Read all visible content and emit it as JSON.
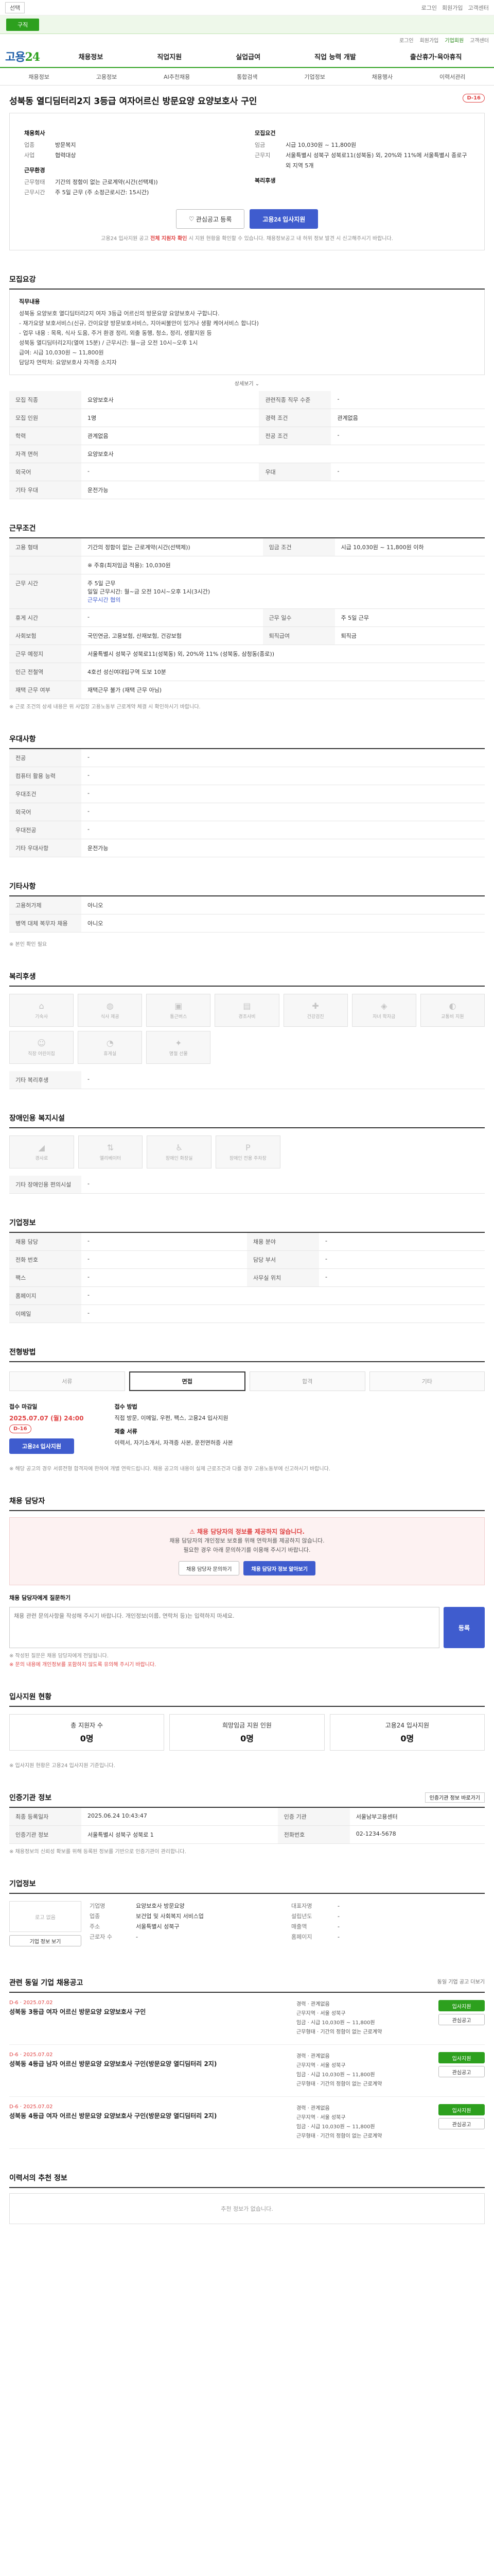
{
  "topbar": {
    "select": "선택",
    "links": [
      "로그인",
      "회원가입",
      "고객센터"
    ]
  },
  "banner": {
    "pill": "구직"
  },
  "util": {
    "links": [
      "로그인",
      "회원가입",
      "기업회원",
      "고객센터"
    ]
  },
  "gnb": {
    "logo_a": "고용",
    "logo_b": "24",
    "menu": [
      "채용정보",
      "직업지원",
      "실업급여",
      "직업 능력 개발",
      "출산휴가·육아휴직"
    ]
  },
  "lnb": [
    "채용정보",
    "고용정보",
    "AI추천채용",
    "통합검색",
    "기업정보",
    "채용행사",
    "이력서관리"
  ],
  "job": {
    "title": "성북동 열디딤터리2지 3등급 여자어르신 방문요양 요양보호사 구인",
    "dday": "D-16"
  },
  "summary": {
    "left_title": "채용회사",
    "left": [
      {
        "k": "업종",
        "v": "방문복지"
      },
      {
        "k": "사업",
        "v": "협력대상"
      }
    ],
    "left_title2": "근무환경",
    "left2": [
      {
        "k": "근무형태",
        "v": "기간의 정함이 없는 근로계약(시간(선택제))"
      },
      {
        "k": "근무시간",
        "v": "주 5일 근무 (주 소정근로시간: 15시간)"
      }
    ],
    "right_title": "모집요건",
    "right": [
      {
        "k": "임금",
        "v": "시급 10,030원 ~ 11,800원"
      },
      {
        "k": "근무지",
        "v": "서울특별시 성북구 성북로11(성북동) 외, 20%와 11%에 서울특별시 종로구 외 지역 5개"
      }
    ],
    "right_title2": "복리후생",
    "right2": [],
    "btn_save": "관심공고 등록",
    "btn_apply": "고용24 입사지원",
    "notice_pre": "고용24 입사지원 공고 ",
    "notice_red": "전체 지원자 확인",
    "notice_post": " 시 지원 현황을 확인할 수 있습니다. 채용정보공고 내 허위 정보 발견 시 신고해주시기 바랍니다."
  },
  "s_offer": {
    "title": "모집요강",
    "desc_label": "직무내용",
    "desc": [
      "성북동 요양보호 열디딤터리2지 여자 3등급 어르신의 방문요양 요양보호사 구합니다.",
      "- 재가요양 보호서비스(신규, 간이요양 방문보호서비스, 지아씨불안이 있거나 생활 케어서비스 합니다)",
      "- 업무 내용 : 목욕, 식사 도움, 주거 환경 정리, 외출 동행, 청소, 정리, 생활지원 등",
      "  성북동 열디딤터리2지(열여 15분) / 근무시간: 월~금 오전 10시~오후 1시",
      "  급여: 시급 10,030원 ~ 11,800원",
      "  담당자 연락처: 요양보호사 자격증 소지자"
    ],
    "more": "상세보기",
    "rows": [
      [
        "모집 직종",
        "요양보호사",
        "관련직종 직무 수준",
        "-"
      ],
      [
        "모집 인원",
        "1명",
        "경력 조건",
        "관계없음"
      ],
      [
        "학력",
        "관계없음",
        "전공 조건",
        "-"
      ],
      [
        "자격 면허",
        "요양보호사",
        "",
        ""
      ],
      [
        "외국어",
        "-",
        "우대",
        "-"
      ],
      [
        "기타 우대",
        "운전가능",
        "",
        ""
      ]
    ]
  },
  "s_work": {
    "title": "근무조건",
    "r1": [
      "고용 형태",
      "기간의 정함이 없는 근로계약(시간(선택제))",
      "임금 조건",
      "시급 10,030원 ~ 11,800원 이하"
    ],
    "wage_note": "※ 주휴(최저임금 적용): 10,030원",
    "time_label": "근무 시간",
    "time_lines": [
      "주 5일 근무",
      "일일 근무시간: 월~금 오전 10시~오후 1시(3시간)",
      "근무시간 협의"
    ],
    "rows": [
      [
        "휴게 시간",
        "-",
        "근무 일수",
        "주 5일 근무"
      ],
      [
        "사회보험",
        "국민연금, 고용보험, 산재보험, 건강보험",
        "퇴직급여",
        "퇴직금"
      ],
      [
        "근무 예정지",
        "서울특별시 성북구 성북로11(성북동) 외, 20%와 11% (성북동, 삼청동(종로))",
        "",
        ""
      ],
      [
        "인근 전철역",
        "4호선 성신여대입구역 도보 10분",
        "",
        ""
      ],
      [
        "재택 근무 여부",
        "재택근무 불가 (재택 근무 아님)",
        "",
        ""
      ]
    ],
    "cap": "※ 근로 조건의 상세 내용은 위 사업장 고용노동부 근로계약 체결 시 확인하시기 바랍니다."
  },
  "s_pref": {
    "title": "우대사항",
    "rows": [
      [
        "전공",
        "-"
      ],
      [
        "컴퓨터 활용 능력",
        "-"
      ],
      [
        "우대조건",
        "-"
      ],
      [
        "외국어",
        "-"
      ],
      [
        "우대전공",
        "-"
      ],
      [
        "기타 우대사항",
        "운전가능"
      ]
    ]
  },
  "s_etc": {
    "title": "기타사항",
    "rows": [
      [
        "고용허가제",
        "아니오"
      ],
      [
        "병역 대체 복무자 채용",
        "아니오"
      ]
    ],
    "note": "※ 본인 확인 필요"
  },
  "s_welfare": {
    "title": "복리후생",
    "icons": [
      [
        "house-icon",
        "기숙사"
      ],
      [
        "meal-icon",
        "식사 제공"
      ],
      [
        "bus-icon",
        "통근버스"
      ],
      [
        "gift-icon",
        "경조사비"
      ],
      [
        "health-icon",
        "건강검진"
      ],
      [
        "support-icon",
        "자녀 학자금"
      ],
      [
        "car-icon",
        "교통비 지원"
      ],
      [
        "child-icon",
        "직장 어린이집"
      ],
      [
        "coffee-icon",
        "휴게실"
      ],
      [
        "party-icon",
        "명절 선물"
      ]
    ],
    "etc_label": "기타 복리후생",
    "etc": "-"
  },
  "s_disability": {
    "title": "장애인용 복지시설",
    "icons": [
      [
        "ramp-icon",
        "경사로"
      ],
      [
        "lift-icon",
        "엘리베이터"
      ],
      [
        "toilet-icon",
        "장애인 화장실"
      ],
      [
        "parking-icon",
        "장애인 전용 주차장"
      ]
    ],
    "etc_label": "기타 장애인용 편의시설",
    "etc": "-"
  },
  "s_company": {
    "title": "채용 담당자",
    "rows": [
      [
        "채용 담당",
        "-"
      ],
      [
        "전화 번호",
        "-"
      ],
      [
        "팩스",
        "-"
      ],
      [
        "홈페이지",
        "-"
      ],
      [
        "이메일",
        "-"
      ]
    ],
    "rows_r": [
      [
        "채용 분야",
        "-"
      ],
      [
        "담당 부서",
        "-"
      ],
      [
        "사무실 위치",
        "-"
      ]
    ],
    "head_label": "기업정보"
  },
  "s_process": {
    "title": "전형방법",
    "steps": [
      "서류",
      "면접",
      "합격",
      "기타"
    ],
    "apply_label": "접수 마감일",
    "apply_date": "2025.07.07 (월) 24:00",
    "apply_dday": "D-16",
    "method_label": "접수 방법",
    "method": "직접 방문, 이메일, 우편, 팩스, 고용24 입사지원",
    "docs_label": "제출 서류",
    "docs": "이력서, 자기소개서, 자격증 사본, 운전면허증 사본",
    "btn_apply": "고용24 입사지원",
    "cap": "※ 해당 공고의 경우 서류전형 합격자에 한하여 개별 연락드립니다. 채용 공고의 내용이 실제 근로조건과 다를 경우 고용노동부에 신고하시기 바랍니다."
  },
  "s_ctc": {
    "title": "채용 담당자",
    "w_title": "채용 담당자의 정보를 제공하지 않습니다.",
    "w_lines": [
      "채용 담당자의 개인정보 보호를 위해 연락처를 제공하지 않습니다.",
      "필요한 경우 아래 문의하기를 이용해 주시기 바랍니다."
    ],
    "w_btn1": "채용 담당자 문의하기",
    "w_btn2": "채용 담당자 정보 알아보기",
    "qna_label": "채용 담당자에게 질문하기",
    "qna_ph": "채용 관련 문의사항을 작성해 주시기 바랍니다. 개인정보(이름, 연락처 등)는 입력하지 마세요.",
    "qna_btn": "등록",
    "cap1": "※ 작성된 질문은 채용 담당자에게 전달됩니다.",
    "cap2": "※ 문의 내용에 개인정보를 포함하지 않도록 유의해 주시기 바랍니다."
  },
  "s_stats": {
    "title": "입사지원 현황",
    "items": [
      [
        "총 지원자 수",
        "0명"
      ],
      [
        "희망임금 지원 인원",
        "0명"
      ],
      [
        "고용24 입사지원",
        "0명"
      ]
    ],
    "cap": "※ 입사지원 현황은 고용24 입사지원 기준입니다."
  },
  "s_reg": {
    "title": "인증기관 정보",
    "link": "인증기관 정보 바로가기",
    "rows": [
      [
        "최종 등록일자",
        "2025.06.24 10:43:47",
        "인증 기관",
        "서울남부고용센터"
      ],
      [
        "인증기관 정보",
        "서울특별시 성북구 성북로 1",
        "전화번호",
        "02-1234-5678"
      ]
    ],
    "cap": "※ 채용정보의 신뢰성 확보를 위해 등록된 정보를 기반으로 인증기관이 관리합니다."
  },
  "s_corp": {
    "title": "기업정보",
    "logo": "로고 없음",
    "link": "기업 정보 보기",
    "left": [
      [
        "기업명",
        "요양보호사 방문요양"
      ],
      [
        "업종",
        "보건업 및 사회복지 서비스업"
      ],
      [
        "주소",
        "서울특별시 성북구"
      ],
      [
        "근로자 수",
        "-"
      ]
    ],
    "right": [
      [
        "대표자명",
        "-"
      ],
      [
        "설립년도",
        "-"
      ],
      [
        "매출액",
        "-"
      ],
      [
        "홈페이지",
        "-"
      ]
    ]
  },
  "s_similar": {
    "title": "관련 동일 기업 채용공고",
    "link": "동일 기업 공고 더보기",
    "jobs": [
      {
        "d": "D-6 · 2025.07.02",
        "t": "성북동 3등급 여자 어르신 방문요양 요양보호사 구인",
        "m": [
          "경력 · 관계없음",
          "근무지역 · 서울 성북구",
          "임금 · 시급 10,030원 ~ 11,800원",
          "근무형태 · 기간의 정함이 없는 근로계약"
        ],
        "b1": "입사지원",
        "b2": "관심공고"
      },
      {
        "d": "D-6 · 2025.07.02",
        "t": "성북동 4등급 남자 어르신 방문요양 요양보호사 구인(방문요양 열디딤터리 2지)",
        "m": [
          "경력 · 관계없음",
          "근무지역 · 서울 성북구",
          "임금 · 시급 10,030원 ~ 11,800원",
          "근무형태 · 기간의 정함이 없는 근로계약"
        ],
        "b1": "입사지원",
        "b2": "관심공고"
      },
      {
        "d": "D-6 · 2025.07.02",
        "t": "성북동 4등급 여자 어르신 방문요양 요양보호사 구인(방문요양 열디딤터리 2지)",
        "m": [
          "경력 · 관계없음",
          "근무지역 · 서울 성북구",
          "임금 · 시급 10,030원 ~ 11,800원",
          "근무형태 · 기간의 정함이 없는 근로계약"
        ],
        "b1": "입사지원",
        "b2": "관심공고"
      }
    ]
  },
  "s_rec": {
    "title": "이력서의 추천 정보",
    "msg": "추천 정보가 없습니다."
  }
}
